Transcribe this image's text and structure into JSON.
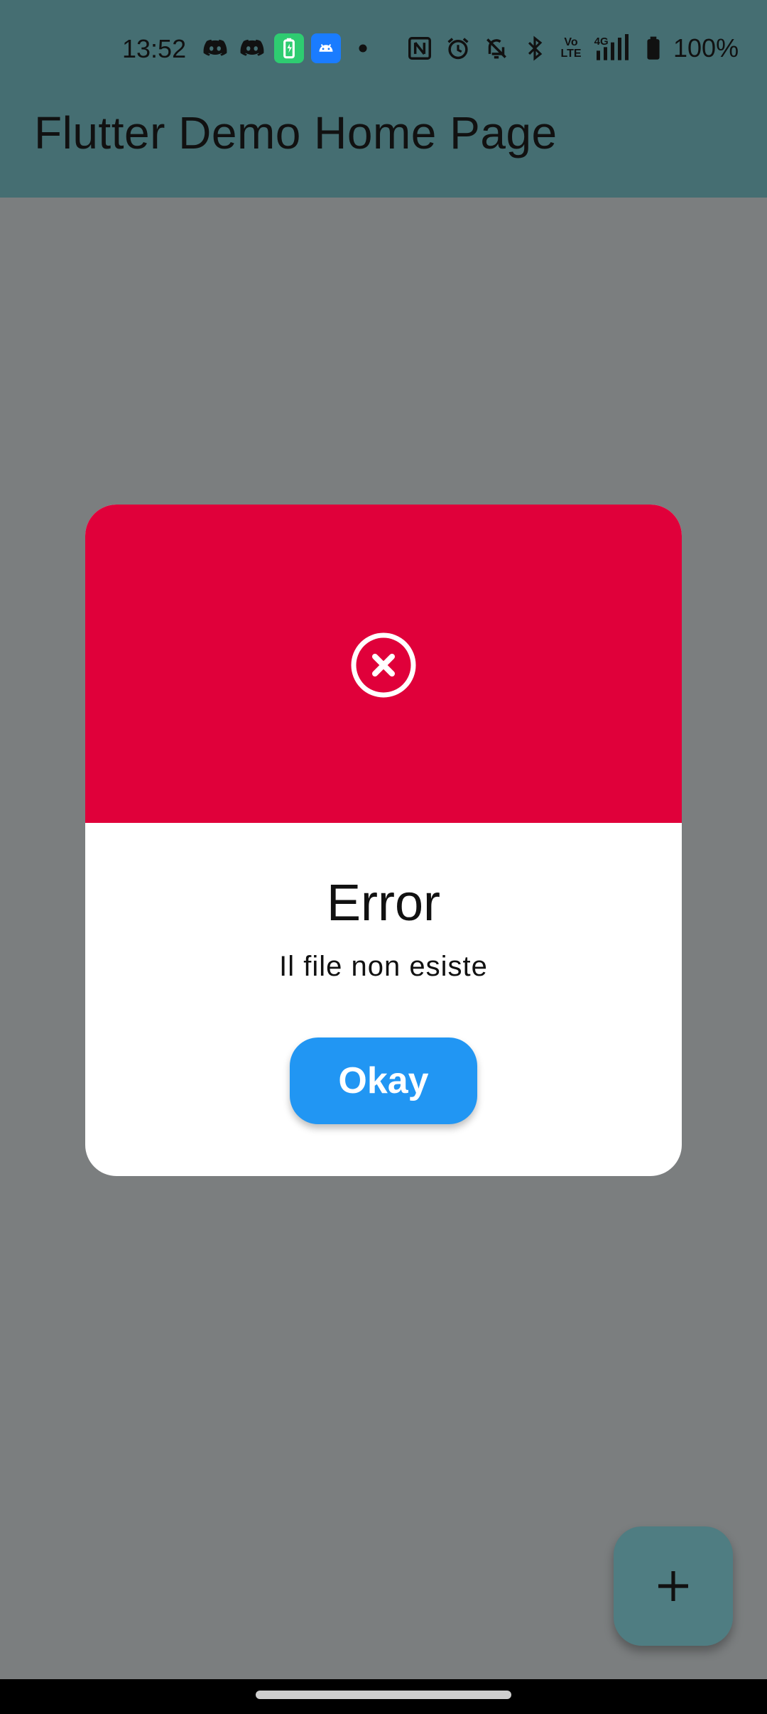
{
  "status_bar": {
    "time": "13:52",
    "battery_percent": "100%",
    "network_label": "4G",
    "volte_label": "Vo LTE",
    "icons": [
      "discord-icon",
      "discord-icon",
      "battery-app-icon",
      "android-icon",
      "dot-icon",
      "nfc-icon",
      "alarm-icon",
      "bell-off-icon",
      "bluetooth-icon",
      "volte-icon",
      "signal-icon",
      "battery-icon"
    ]
  },
  "app_bar": {
    "title": "Flutter Demo Home Page"
  },
  "dialog": {
    "icon": "error-circle-x-icon",
    "title": "Error",
    "message": "Il file non esiste",
    "button_label": "Okay",
    "colors": {
      "header": "#e0003a",
      "button": "#2196f3"
    }
  },
  "fab": {
    "icon": "plus-icon"
  }
}
